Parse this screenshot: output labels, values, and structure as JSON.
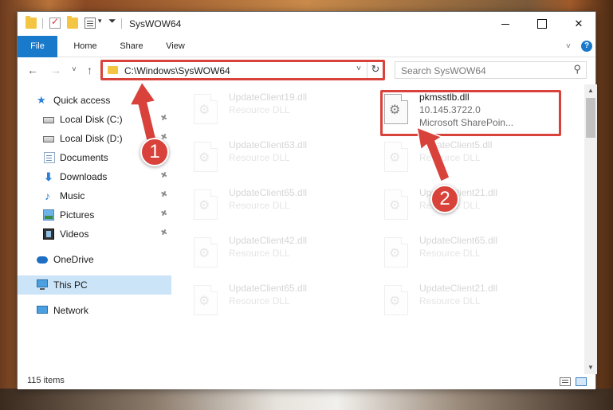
{
  "window": {
    "title": "SysWOW64",
    "controls": {
      "minimize": "",
      "maximize": "",
      "close": "✕"
    }
  },
  "ribbon": {
    "tabs": [
      "File",
      "Home",
      "Share",
      "View"
    ],
    "help": "?"
  },
  "nav": {
    "back": "←",
    "forward": "→",
    "recent": "˅",
    "up": "↑",
    "address": "C:\\Windows\\SysWOW64",
    "address_chevron": "˅",
    "refresh": "↻",
    "search_placeholder": "Search SysWOW64",
    "search_icon": "⚲"
  },
  "sidebar": {
    "items": [
      {
        "label": "Quick access",
        "icon": "star-icon",
        "pinned": false
      },
      {
        "label": "Local Disk (C:)",
        "icon": "drive-icon",
        "pinned": true
      },
      {
        "label": "Local Disk (D:)",
        "icon": "drive-icon",
        "pinned": true
      },
      {
        "label": "Documents",
        "icon": "documents-icon",
        "pinned": true
      },
      {
        "label": "Downloads",
        "icon": "downloads-icon",
        "pinned": true
      },
      {
        "label": "Music",
        "icon": "music-icon",
        "pinned": true
      },
      {
        "label": "Pictures",
        "icon": "pictures-icon",
        "pinned": true
      },
      {
        "label": "Videos",
        "icon": "videos-icon",
        "pinned": true
      },
      {
        "label": "OneDrive",
        "icon": "onedrive-icon",
        "pinned": false
      },
      {
        "label": "This PC",
        "icon": "pc-icon",
        "pinned": false,
        "selected": true
      },
      {
        "label": "Network",
        "icon": "network-icon",
        "pinned": false
      }
    ],
    "pin_glyph": "📌"
  },
  "files": [
    {
      "name": "UpdateClient19.dll",
      "type": "Resource DLL",
      "faded": true
    },
    {
      "name": "pkmsstlb.dll",
      "version": "10.145.3722.0",
      "company": "Microsoft SharePoin...",
      "faded": false,
      "highlighted": true
    },
    {
      "name": "UpdateClient63.dll",
      "type": "Resource DLL",
      "faded": true
    },
    {
      "name": "UpdateClient5.dll",
      "type": "Resource DLL",
      "faded": true
    },
    {
      "name": "UpdateClient65.dll",
      "type": "Resource DLL",
      "faded": true
    },
    {
      "name": "UpdateClient21.dll",
      "type": "Resource DLL",
      "faded": true
    },
    {
      "name": "UpdateClient42.dll",
      "type": "Resource DLL",
      "faded": true
    },
    {
      "name": "UpdateClient65.dll",
      "type": "Resource DLL",
      "faded": true
    },
    {
      "name": "UpdateClient65.dll",
      "type": "Resource DLL",
      "faded": true
    },
    {
      "name": "UpdateClient21.dll",
      "type": "Resource DLL",
      "faded": true
    }
  ],
  "status": {
    "item_count": "115 items"
  },
  "annotations": {
    "badge1": "1",
    "badge2": "2",
    "color": "#d9423b"
  },
  "colors": {
    "accent": "#1979ca",
    "selection": "#cce4f7",
    "highlight": "#d9423b"
  }
}
